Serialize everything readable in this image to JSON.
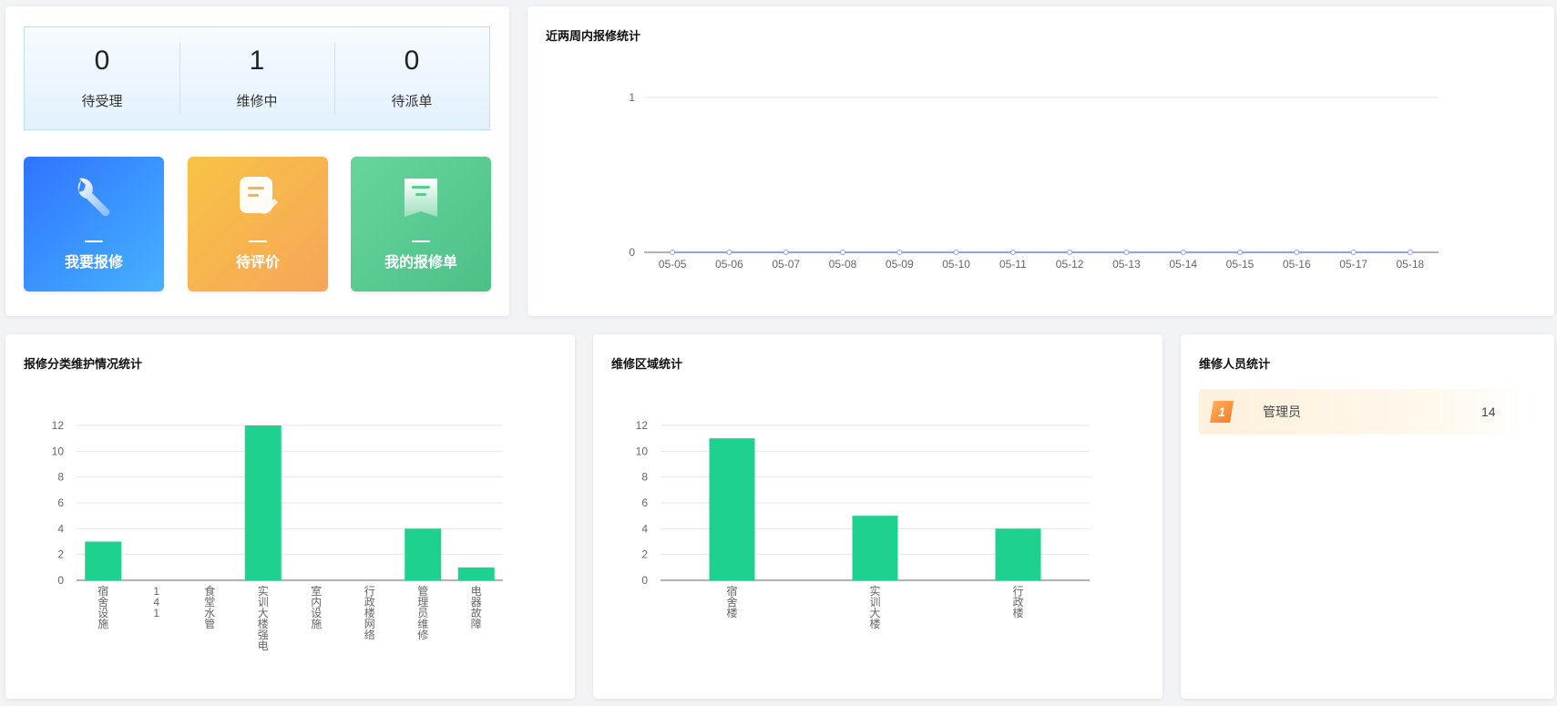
{
  "stats": [
    {
      "value": "0",
      "label": "待受理"
    },
    {
      "value": "1",
      "label": "维修中"
    },
    {
      "value": "0",
      "label": "待派单"
    }
  ],
  "tiles": [
    {
      "label": "我要报修",
      "icon": "wrench-icon"
    },
    {
      "label": "待评价",
      "icon": "edit-note-icon"
    },
    {
      "label": "我的报修单",
      "icon": "repair-order-icon"
    }
  ],
  "colors": {
    "bar": "#1fd18e",
    "line": "#8fa3e8",
    "tile_blue": "#2f74ff",
    "tile_orange": "#f7a55a",
    "tile_green": "#4cc088"
  },
  "trend": {
    "title": "近两周内报修统计"
  },
  "category": {
    "title": "报修分类维护情况统计"
  },
  "region": {
    "title": "维修区域统计"
  },
  "staff": {
    "title": "维修人员统计",
    "rows": [
      {
        "rank": "1",
        "name": "管理员",
        "count": "14"
      }
    ]
  },
  "chart_data": [
    {
      "type": "line",
      "title": "近两周内报修统计",
      "x": [
        "05-05",
        "05-06",
        "05-07",
        "05-08",
        "05-09",
        "05-10",
        "05-11",
        "05-12",
        "05-13",
        "05-14",
        "05-15",
        "05-16",
        "05-17",
        "05-18"
      ],
      "series": [
        {
          "values": [
            0,
            0,
            0,
            0,
            0,
            0,
            0,
            0,
            0,
            0,
            0,
            0,
            0,
            0
          ]
        }
      ],
      "ylim": [
        0,
        1
      ],
      "yticks": [
        0,
        1
      ],
      "grid": true
    },
    {
      "type": "bar",
      "title": "报修分类维护情况统计",
      "categories": [
        "宿舍设施",
        "141",
        "食堂水管",
        "实训大楼强电",
        "室内设施",
        "行政楼网络",
        "管理员维修",
        "电器故障"
      ],
      "values": [
        3,
        0,
        0,
        12,
        0,
        0,
        4,
        1
      ],
      "ylim": [
        0,
        12
      ],
      "yticks": [
        0,
        2,
        4,
        6,
        8,
        10,
        12
      ],
      "grid": true
    },
    {
      "type": "bar",
      "title": "维修区域统计",
      "categories": [
        "宿舍楼",
        "实训大楼",
        "行政楼"
      ],
      "values": [
        11,
        5,
        4
      ],
      "ylim": [
        0,
        12
      ],
      "yticks": [
        0,
        2,
        4,
        6,
        8,
        10,
        12
      ],
      "grid": true
    }
  ]
}
